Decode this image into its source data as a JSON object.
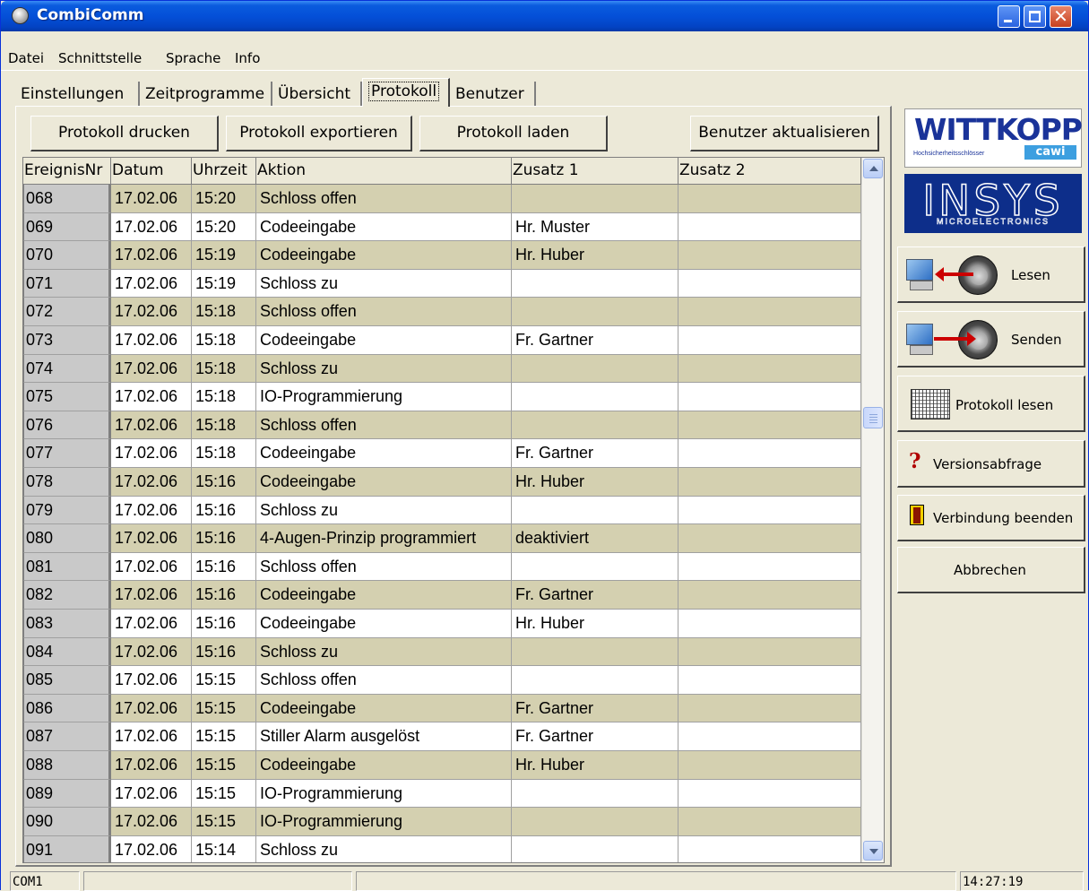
{
  "window": {
    "title": "CombiComm"
  },
  "menu": [
    {
      "label": "Datei"
    },
    {
      "label": "Schnittstelle"
    },
    {
      "label": "Sprache"
    },
    {
      "label": "Info"
    }
  ],
  "tabs": [
    {
      "label": "Einstellungen"
    },
    {
      "label": "Zeitprogramme"
    },
    {
      "label": "Übersicht"
    },
    {
      "label": "Protokoll",
      "active": true
    },
    {
      "label": "Benutzer"
    }
  ],
  "toolbar": {
    "print_label": "Protokoll drucken",
    "export_label": "Protokoll exportieren",
    "load_label": "Protokoll laden",
    "update_users_label": "Benutzer aktualisieren"
  },
  "table": {
    "columns": [
      "EreignisNr",
      "Datum",
      "Uhrzeit",
      "Aktion",
      "Zusatz 1",
      "Zusatz 2"
    ],
    "rows": [
      {
        "nr": "068",
        "datum": "17.02.06",
        "uhrzeit": "15:20",
        "aktion": "Schloss offen",
        "zusatz1": "",
        "zusatz2": ""
      },
      {
        "nr": "069",
        "datum": "17.02.06",
        "uhrzeit": "15:20",
        "aktion": "Codeeingabe",
        "zusatz1": "Hr. Muster",
        "zusatz2": ""
      },
      {
        "nr": "070",
        "datum": "17.02.06",
        "uhrzeit": "15:19",
        "aktion": "Codeeingabe",
        "zusatz1": "Hr. Huber",
        "zusatz2": ""
      },
      {
        "nr": "071",
        "datum": "17.02.06",
        "uhrzeit": "15:19",
        "aktion": "Schloss zu",
        "zusatz1": "",
        "zusatz2": ""
      },
      {
        "nr": "072",
        "datum": "17.02.06",
        "uhrzeit": "15:18",
        "aktion": "Schloss offen",
        "zusatz1": "",
        "zusatz2": ""
      },
      {
        "nr": "073",
        "datum": "17.02.06",
        "uhrzeit": "15:18",
        "aktion": "Codeeingabe",
        "zusatz1": "Fr. Gartner",
        "zusatz2": ""
      },
      {
        "nr": "074",
        "datum": "17.02.06",
        "uhrzeit": "15:18",
        "aktion": "Schloss zu",
        "zusatz1": "",
        "zusatz2": ""
      },
      {
        "nr": "075",
        "datum": "17.02.06",
        "uhrzeit": "15:18",
        "aktion": "IO-Programmierung",
        "zusatz1": "",
        "zusatz2": ""
      },
      {
        "nr": "076",
        "datum": "17.02.06",
        "uhrzeit": "15:18",
        "aktion": "Schloss offen",
        "zusatz1": "",
        "zusatz2": ""
      },
      {
        "nr": "077",
        "datum": "17.02.06",
        "uhrzeit": "15:18",
        "aktion": "Codeeingabe",
        "zusatz1": "Fr. Gartner",
        "zusatz2": ""
      },
      {
        "nr": "078",
        "datum": "17.02.06",
        "uhrzeit": "15:16",
        "aktion": "Codeeingabe",
        "zusatz1": "Hr. Huber",
        "zusatz2": ""
      },
      {
        "nr": "079",
        "datum": "17.02.06",
        "uhrzeit": "15:16",
        "aktion": "Schloss zu",
        "zusatz1": "",
        "zusatz2": ""
      },
      {
        "nr": "080",
        "datum": "17.02.06",
        "uhrzeit": "15:16",
        "aktion": "4-Augen-Prinzip programmiert",
        "zusatz1": "deaktiviert",
        "zusatz2": ""
      },
      {
        "nr": "081",
        "datum": "17.02.06",
        "uhrzeit": "15:16",
        "aktion": "Schloss offen",
        "zusatz1": "",
        "zusatz2": ""
      },
      {
        "nr": "082",
        "datum": "17.02.06",
        "uhrzeit": "15:16",
        "aktion": "Codeeingabe",
        "zusatz1": "Fr. Gartner",
        "zusatz2": ""
      },
      {
        "nr": "083",
        "datum": "17.02.06",
        "uhrzeit": "15:16",
        "aktion": "Codeeingabe",
        "zusatz1": "Hr. Huber",
        "zusatz2": ""
      },
      {
        "nr": "084",
        "datum": "17.02.06",
        "uhrzeit": "15:16",
        "aktion": "Schloss zu",
        "zusatz1": "",
        "zusatz2": ""
      },
      {
        "nr": "085",
        "datum": "17.02.06",
        "uhrzeit": "15:15",
        "aktion": "Schloss offen",
        "zusatz1": "",
        "zusatz2": ""
      },
      {
        "nr": "086",
        "datum": "17.02.06",
        "uhrzeit": "15:15",
        "aktion": "Codeeingabe",
        "zusatz1": "Fr. Gartner",
        "zusatz2": ""
      },
      {
        "nr": "087",
        "datum": "17.02.06",
        "uhrzeit": "15:15",
        "aktion": "Stiller Alarm ausgelöst",
        "zusatz1": "Fr. Gartner",
        "zusatz2": ""
      },
      {
        "nr": "088",
        "datum": "17.02.06",
        "uhrzeit": "15:15",
        "aktion": "Codeeingabe",
        "zusatz1": "Hr. Huber",
        "zusatz2": ""
      },
      {
        "nr": "089",
        "datum": "17.02.06",
        "uhrzeit": "15:15",
        "aktion": "IO-Programmierung",
        "zusatz1": "",
        "zusatz2": ""
      },
      {
        "nr": "090",
        "datum": "17.02.06",
        "uhrzeit": "15:15",
        "aktion": "IO-Programmierung",
        "zusatz1": "",
        "zusatz2": ""
      },
      {
        "nr": "091",
        "datum": "17.02.06",
        "uhrzeit": "15:14",
        "aktion": "Schloss zu",
        "zusatz1": "",
        "zusatz2": ""
      }
    ]
  },
  "logos": {
    "wittkopp": "WITTKOPP",
    "wittkopp_sub": "Hochsicherheitsschlösser",
    "cawi": "cawi",
    "insys": "INSYS",
    "insys_sub": "MICROELECTRONICS"
  },
  "side_buttons": {
    "lesen": "Lesen",
    "senden": "Senden",
    "protokoll_lesen": "Protokoll lesen",
    "versionsabfrage": "Versionsabfrage",
    "verbindung_beenden": "Verbindung beenden",
    "abbrechen": "Abbrechen"
  },
  "status": {
    "port": "COM1",
    "middle": "",
    "right": "",
    "time": "14:27:19"
  },
  "colors": {
    "title_bar": "#0450d8",
    "row_alt": "#d4d0b0",
    "window_bg": "#ece9d8"
  }
}
